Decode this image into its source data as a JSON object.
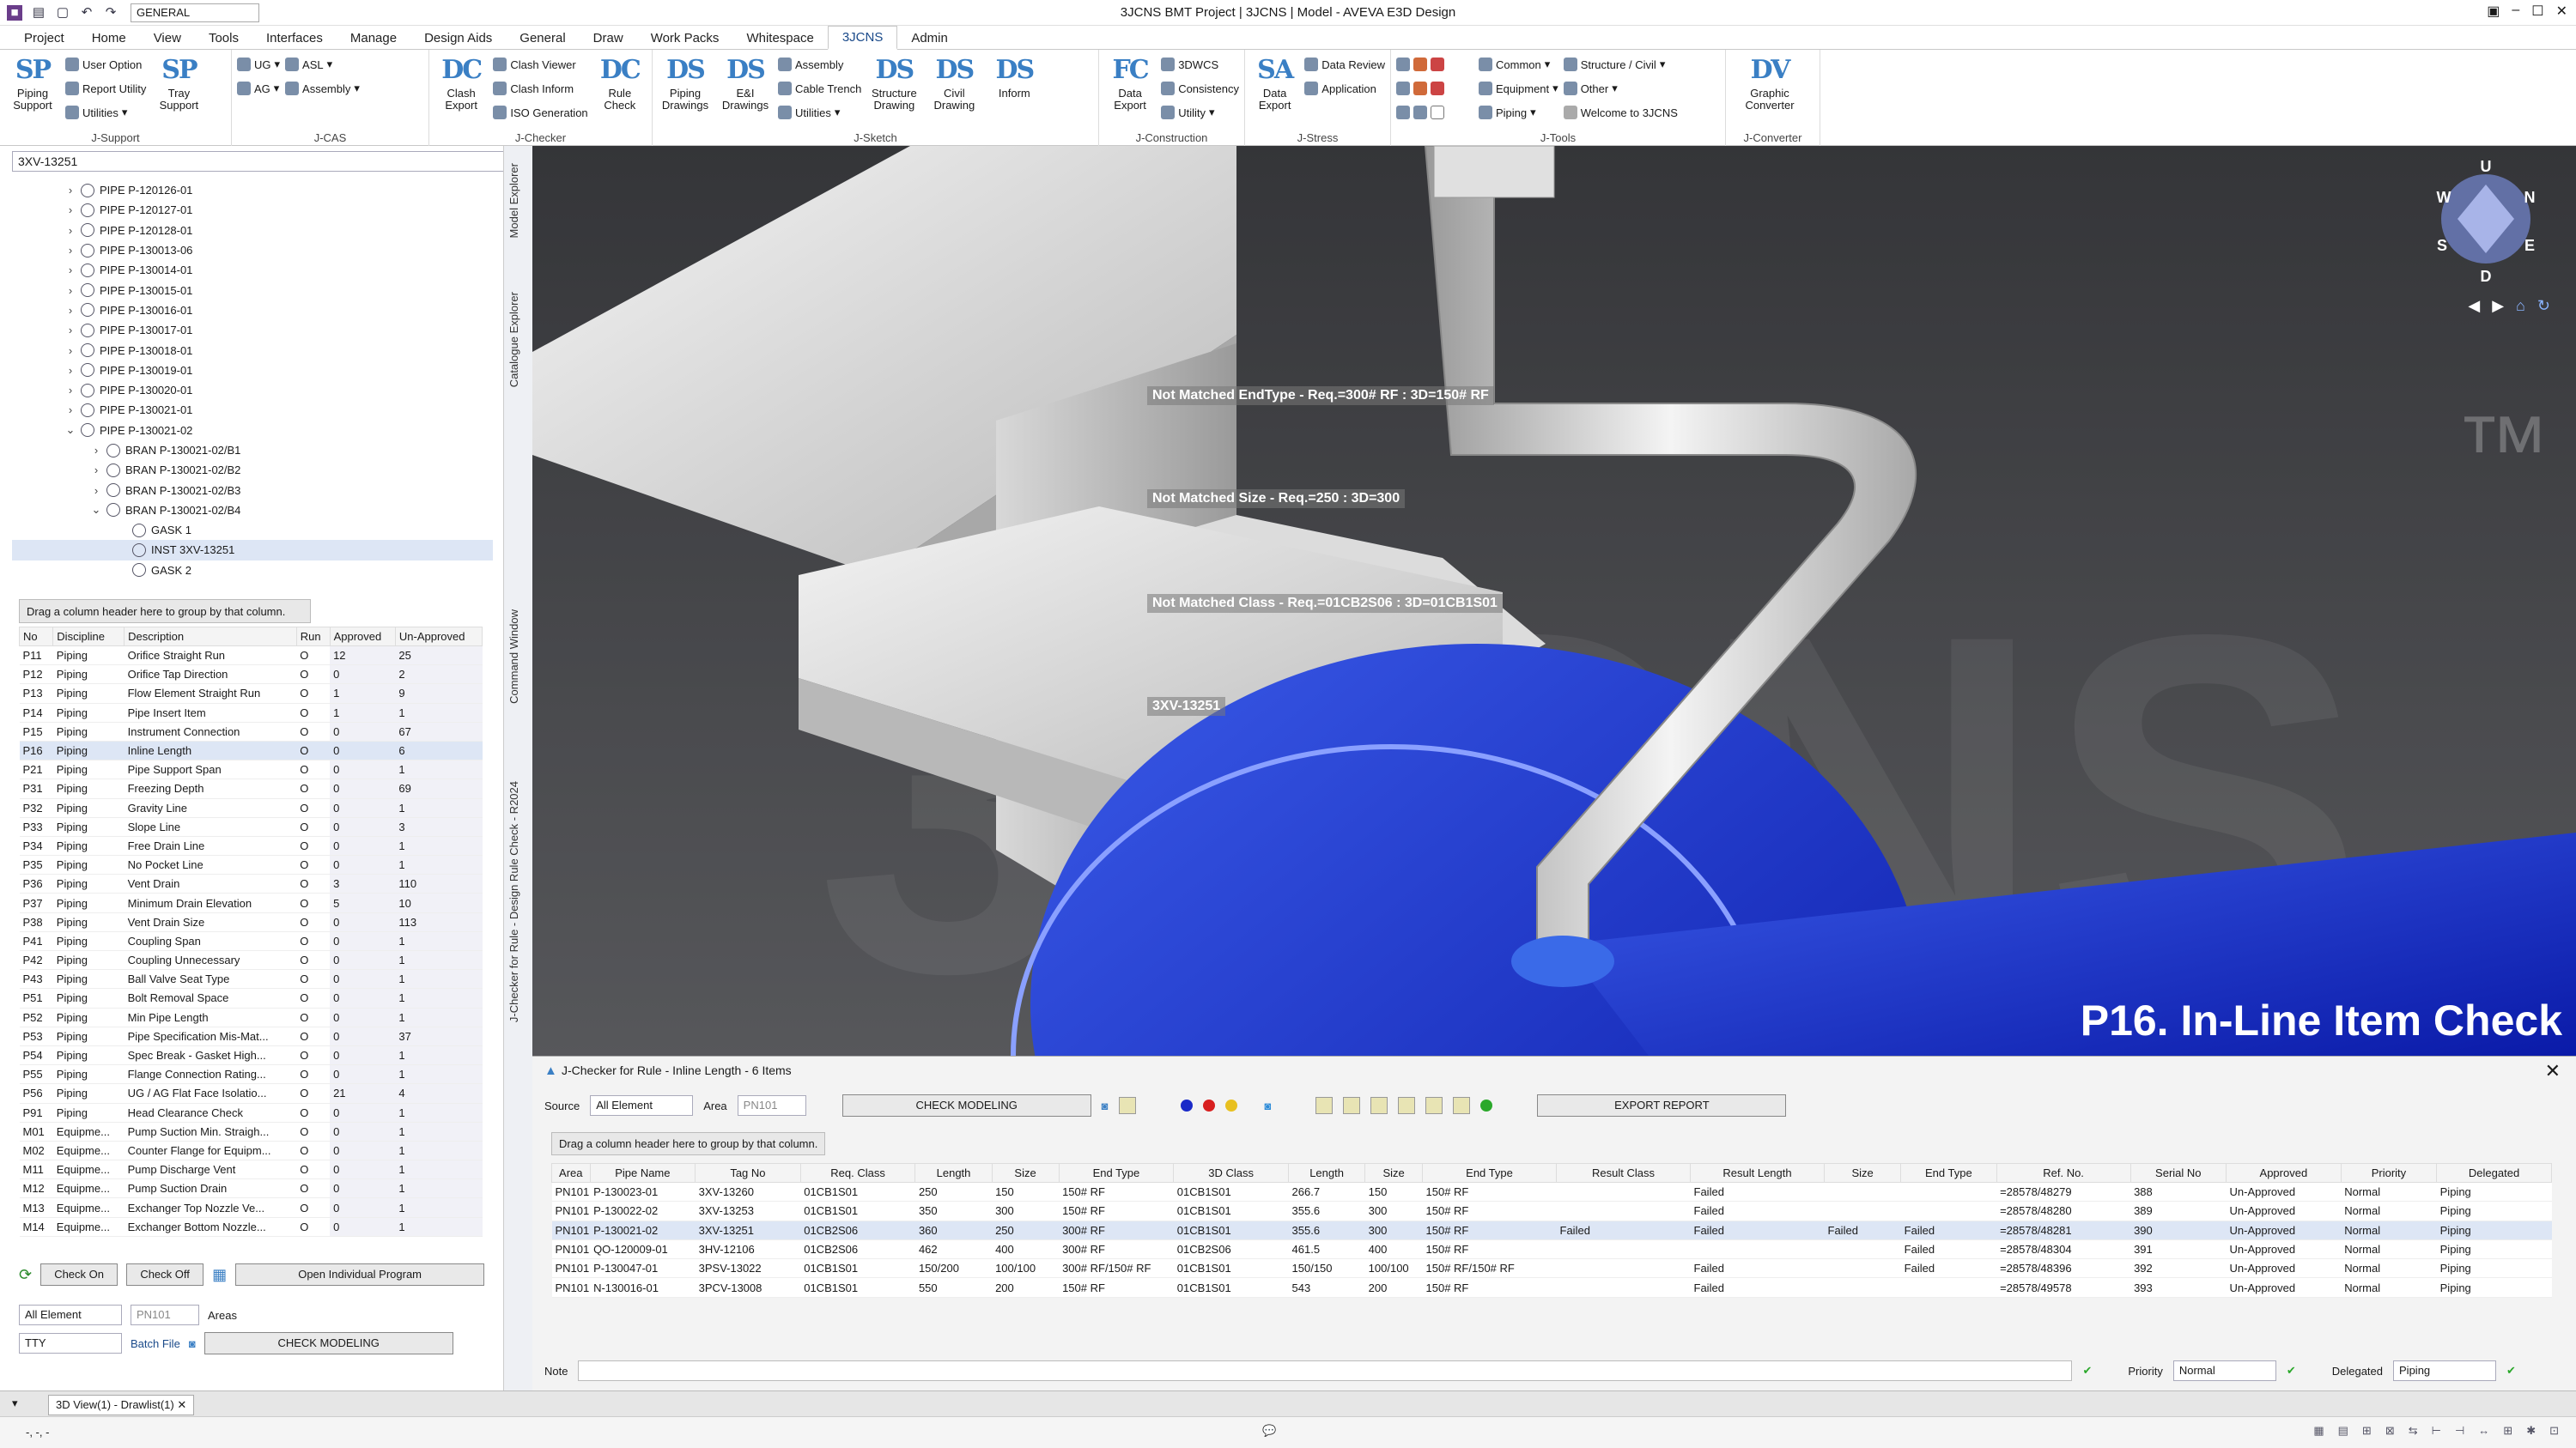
{
  "window": {
    "title": "3JCNS BMT Project | 3JCNS | Model - AVEVA E3D Design",
    "workspace": "GENERAL"
  },
  "menu_tabs": [
    "Project",
    "Home",
    "View",
    "Tools",
    "Interfaces",
    "Manage",
    "Design Aids",
    "General",
    "Draw",
    "Work Packs",
    "Whitespace",
    "3JCNS",
    "Admin"
  ],
  "ribbon": {
    "jsupport": {
      "label": "J-Support",
      "big1_icon": "SP",
      "big1": "Piping\nSupport",
      "small": [
        "User Option",
        "Report Utility",
        "Utilities"
      ],
      "big2_icon": "SP",
      "big2": "Tray\nSupport"
    },
    "jcas": {
      "label": "J-CAS",
      "small": [
        "UG",
        "AG",
        "ASL",
        "Assembly"
      ]
    },
    "jchecker": {
      "label": "J-Checker",
      "big1_icon": "DC",
      "big1": "Clash\nExport",
      "small": [
        "Clash Viewer",
        "Clash Inform",
        "ISO Generation"
      ],
      "big2_icon": "DC",
      "big2": "Rule\nCheck"
    },
    "jsketch": {
      "label": "J-Sketch",
      "big1_icon": "DS",
      "big1": "Piping\nDrawings",
      "big2_icon": "DS",
      "big2": "E&I\nDrawings",
      "small": [
        "Assembly",
        "Cable Trench",
        "Utilities"
      ],
      "big3_icon": "DS",
      "big3": "Structure\nDrawing",
      "big4_icon": "DS",
      "big4": "Civil\nDrawing",
      "big5_icon": "DS",
      "big5": "Inform"
    },
    "jconstruction": {
      "label": "J-Construction",
      "big1_icon": "FC",
      "big1": "Data\nExport",
      "small": [
        "3DWCS",
        "Consistency",
        "Utility"
      ]
    },
    "jstress": {
      "label": "J-Stress",
      "big1_icon": "SA",
      "big1": "Data\nExport",
      "small": [
        "Data Review",
        "Application"
      ]
    },
    "jtools": {
      "label": "J-Tools",
      "small": [
        "Common",
        "Equipment",
        "Piping",
        "Structure / Civil",
        "Other",
        "Welcome to 3JCNS"
      ]
    },
    "jconverter": {
      "label": "J-Converter",
      "big1_icon": "DV",
      "big1": "Graphic\nConverter"
    }
  },
  "explorer": {
    "search_value": "3XV-13251",
    "tabs": [
      "Model Explorer",
      "Catalogue Explorer",
      "Command Window",
      "J-Checker for Rule - Design Rule Check - R2024"
    ],
    "tree": [
      {
        "label": "PIPE P-120126-01",
        "indent": 1,
        "exp": ">"
      },
      {
        "label": "PIPE P-120127-01",
        "indent": 1,
        "exp": ">"
      },
      {
        "label": "PIPE P-120128-01",
        "indent": 1,
        "exp": ">"
      },
      {
        "label": "PIPE P-130013-06",
        "indent": 1,
        "exp": ">"
      },
      {
        "label": "PIPE P-130014-01",
        "indent": 1,
        "exp": ">"
      },
      {
        "label": "PIPE P-130015-01",
        "indent": 1,
        "exp": ">"
      },
      {
        "label": "PIPE P-130016-01",
        "indent": 1,
        "exp": ">"
      },
      {
        "label": "PIPE P-130017-01",
        "indent": 1,
        "exp": ">"
      },
      {
        "label": "PIPE P-130018-01",
        "indent": 1,
        "exp": ">"
      },
      {
        "label": "PIPE P-130019-01",
        "indent": 1,
        "exp": ">"
      },
      {
        "label": "PIPE P-130020-01",
        "indent": 1,
        "exp": ">"
      },
      {
        "label": "PIPE P-130021-01",
        "indent": 1,
        "exp": ">"
      },
      {
        "label": "PIPE P-130021-02",
        "indent": 1,
        "exp": "v"
      },
      {
        "label": "BRAN P-130021-02/B1",
        "indent": 2,
        "exp": ">"
      },
      {
        "label": "BRAN P-130021-02/B2",
        "indent": 2,
        "exp": ">"
      },
      {
        "label": "BRAN P-130021-02/B3",
        "indent": 2,
        "exp": ">"
      },
      {
        "label": "BRAN P-130021-02/B4",
        "indent": 2,
        "exp": "v"
      },
      {
        "label": "GASK 1",
        "indent": 3,
        "exp": ""
      },
      {
        "label": "INST 3XV-13251",
        "indent": 3,
        "exp": "",
        "sel": true
      },
      {
        "label": "GASK 2",
        "indent": 3,
        "exp": ""
      }
    ]
  },
  "rules_grid": {
    "hint": "Drag a column header here to group by that column.",
    "columns": [
      "No",
      "Discipline",
      "Description",
      "Run",
      "Approved",
      "Un-Approved"
    ],
    "rows": [
      [
        "P11",
        "Piping",
        "Orifice Straight Run",
        "O",
        "12",
        "25"
      ],
      [
        "P12",
        "Piping",
        "Orifice Tap Direction",
        "O",
        "0",
        "2"
      ],
      [
        "P13",
        "Piping",
        "Flow Element Straight Run",
        "O",
        "1",
        "9"
      ],
      [
        "P14",
        "Piping",
        "Pipe Insert Item",
        "O",
        "1",
        "1"
      ],
      [
        "P15",
        "Piping",
        "Instrument Connection",
        "O",
        "0",
        "67"
      ],
      [
        "P16",
        "Piping",
        "Inline Length",
        "O",
        "0",
        "6"
      ],
      [
        "P21",
        "Piping",
        "Pipe Support Span",
        "O",
        "0",
        "1"
      ],
      [
        "P31",
        "Piping",
        "Freezing Depth",
        "O",
        "0",
        "69"
      ],
      [
        "P32",
        "Piping",
        "Gravity Line",
        "O",
        "0",
        "1"
      ],
      [
        "P33",
        "Piping",
        "Slope Line",
        "O",
        "0",
        "3"
      ],
      [
        "P34",
        "Piping",
        "Free Drain Line",
        "O",
        "0",
        "1"
      ],
      [
        "P35",
        "Piping",
        "No Pocket Line",
        "O",
        "0",
        "1"
      ],
      [
        "P36",
        "Piping",
        "Vent Drain",
        "O",
        "3",
        "110"
      ],
      [
        "P37",
        "Piping",
        "Minimum Drain Elevation",
        "O",
        "5",
        "10"
      ],
      [
        "P38",
        "Piping",
        "Vent Drain Size",
        "O",
        "0",
        "113"
      ],
      [
        "P41",
        "Piping",
        "Coupling Span",
        "O",
        "0",
        "1"
      ],
      [
        "P42",
        "Piping",
        "Coupling Unnecessary",
        "O",
        "0",
        "1"
      ],
      [
        "P43",
        "Piping",
        "Ball Valve Seat Type",
        "O",
        "0",
        "1"
      ],
      [
        "P51",
        "Piping",
        "Bolt Removal Space",
        "O",
        "0",
        "1"
      ],
      [
        "P52",
        "Piping",
        "Min Pipe Length",
        "O",
        "0",
        "1"
      ],
      [
        "P53",
        "Piping",
        "Pipe Specification Mis-Mat...",
        "O",
        "0",
        "37"
      ],
      [
        "P54",
        "Piping",
        "Spec Break - Gasket High...",
        "O",
        "0",
        "1"
      ],
      [
        "P55",
        "Piping",
        "Flange Connection Rating...",
        "O",
        "0",
        "1"
      ],
      [
        "P56",
        "Piping",
        "UG / AG Flat Face Isolatio...",
        "O",
        "21",
        "4"
      ],
      [
        "P91",
        "Piping",
        "Head Clearance Check",
        "O",
        "0",
        "1"
      ],
      [
        "M01",
        "Equipme...",
        "Pump Suction Min. Straigh...",
        "O",
        "0",
        "1"
      ],
      [
        "M02",
        "Equipme...",
        "Counter Flange for Equipm...",
        "O",
        "0",
        "1"
      ],
      [
        "M11",
        "Equipme...",
        "Pump Discharge Vent",
        "O",
        "0",
        "1"
      ],
      [
        "M12",
        "Equipme...",
        "Pump Suction Drain",
        "O",
        "0",
        "1"
      ],
      [
        "M13",
        "Equipme...",
        "Exchanger Top Nozzle Ve...",
        "O",
        "0",
        "1"
      ],
      [
        "M14",
        "Equipme...",
        "Exchanger Bottom Nozzle...",
        "O",
        "0",
        "1"
      ]
    ],
    "selected_row": 5
  },
  "left_controls": {
    "check_on": "Check On",
    "check_off": "Check Off",
    "open_program": "Open Individual Program",
    "element_select": "All Element",
    "area_select": "PN101",
    "areas_label": "Areas",
    "tty_select": "TTY",
    "batch_file": "Batch File",
    "check_modeling": "CHECK MODELING"
  },
  "viewport": {
    "annotations": [
      "Not Matched EndType - Req.=300# RF : 3D=150# RF",
      "Not Matched Size - Req.=250 : 3D=300",
      "Not Matched Class - Req.=01CB2S06 : 3D=01CB1S01",
      "3XV-13251"
    ],
    "watermark": "P16. In-Line Item Check",
    "nav_cube": {
      "up": "U",
      "down": "D",
      "w": "W",
      "n": "N",
      "s": "S",
      "e": "E"
    }
  },
  "checker_panel": {
    "title": "J-Checker for Rule - Inline Length - 6 Items",
    "source_label": "Source",
    "source_value": "All Element",
    "area_label": "Area",
    "area_value": "PN101",
    "check_modeling": "CHECK MODELING",
    "export_report": "EXPORT REPORT",
    "hint": "Drag a column header here to group by that column.",
    "columns": [
      "Area",
      "Pipe Name",
      "Tag No",
      "Req. Class",
      "Length",
      "Size",
      "End Type",
      "3D Class",
      "Length",
      "Size",
      "End Type",
      "Result Class",
      "Result Length",
      "Size",
      "End Type",
      "Ref. No.",
      "Serial No",
      "Approved",
      "Priority",
      "Delegated"
    ],
    "rows": [
      [
        "PN101",
        "P-130023-01",
        "3XV-13260",
        "01CB1S01",
        "250",
        "150",
        "150# RF",
        "01CB1S01",
        "266.7",
        "150",
        "150# RF",
        "",
        "Failed",
        "",
        "",
        "=28578/48279",
        "388",
        "Un-Approved",
        "Normal",
        "Piping"
      ],
      [
        "PN101",
        "P-130022-02",
        "3XV-13253",
        "01CB1S01",
        "350",
        "300",
        "150# RF",
        "01CB1S01",
        "355.6",
        "300",
        "150# RF",
        "",
        "Failed",
        "",
        "",
        "=28578/48280",
        "389",
        "Un-Approved",
        "Normal",
        "Piping"
      ],
      [
        "PN101",
        "P-130021-02",
        "3XV-13251",
        "01CB2S06",
        "360",
        "250",
        "300# RF",
        "01CB1S01",
        "355.6",
        "300",
        "150# RF",
        "Failed",
        "Failed",
        "Failed",
        "Failed",
        "=28578/48281",
        "390",
        "Un-Approved",
        "Normal",
        "Piping"
      ],
      [
        "PN101",
        "QO-120009-01",
        "3HV-12106",
        "01CB2S06",
        "462",
        "400",
        "300# RF",
        "01CB2S06",
        "461.5",
        "400",
        "150# RF",
        "",
        "",
        "",
        "Failed",
        "=28578/48304",
        "391",
        "Un-Approved",
        "Normal",
        "Piping"
      ],
      [
        "PN101",
        "P-130047-01",
        "3PSV-13022",
        "01CB1S01",
        "150/200",
        "100/100",
        "300# RF/150# RF",
        "01CB1S01",
        "150/150",
        "100/100",
        "150# RF/150# RF",
        "",
        "Failed",
        "",
        "Failed",
        "=28578/48396",
        "392",
        "Un-Approved",
        "Normal",
        "Piping"
      ],
      [
        "PN101",
        "N-130016-01",
        "3PCV-13008",
        "01CB1S01",
        "550",
        "200",
        "150# RF",
        "01CB1S01",
        "543",
        "200",
        "150# RF",
        "",
        "Failed",
        "",
        "",
        "=28578/49578",
        "393",
        "Un-Approved",
        "Normal",
        "Piping"
      ]
    ],
    "selected_row": 2,
    "note_label": "Note",
    "priority_label": "Priority",
    "priority_value": "Normal",
    "delegated_label": "Delegated",
    "delegated_value": "Piping"
  },
  "bottom": {
    "view_tab": "3D View(1) - Drawlist(1)",
    "status_left": "-, -, -"
  }
}
